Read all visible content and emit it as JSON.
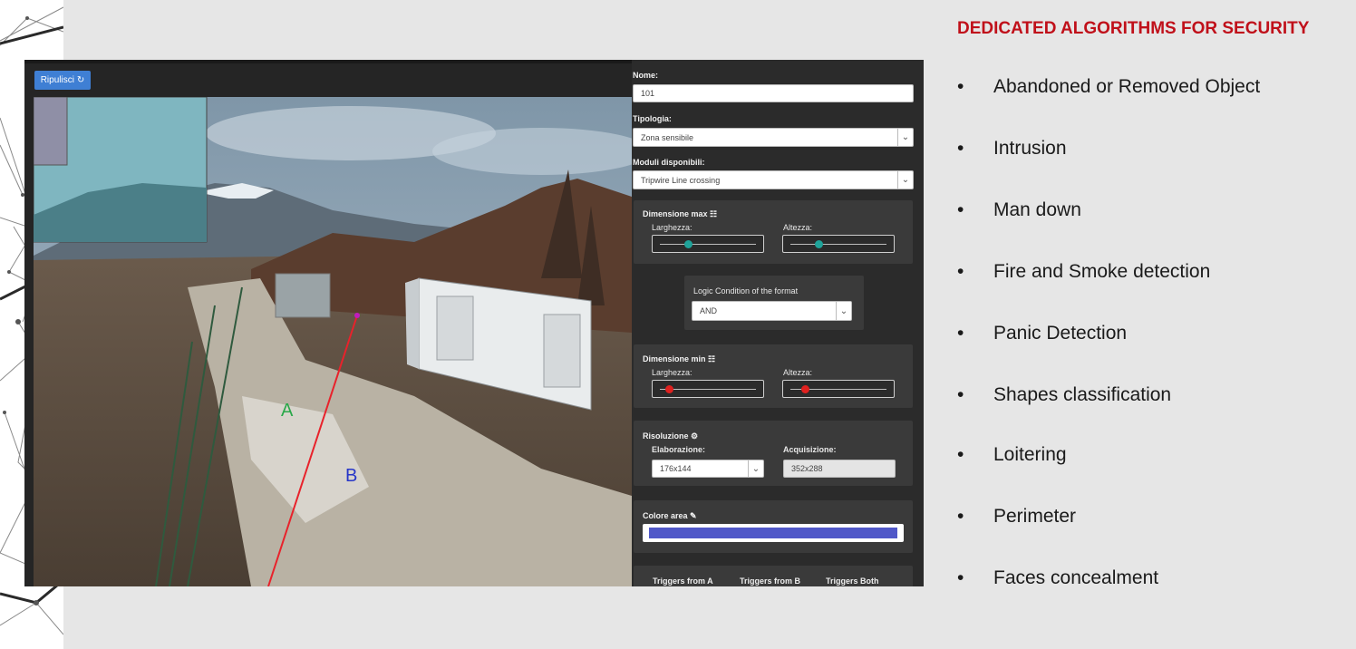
{
  "slide": {
    "title": "DEDICATED ALGORITHMS FOR SECURITY",
    "bullets": [
      "Abandoned or Removed Object",
      "Intrusion",
      "Man down",
      "Fire and Smoke detection",
      "Panic Detection",
      "Shapes classification",
      "Loitering",
      "Perimeter",
      "Faces concealment"
    ]
  },
  "toolbar": {
    "reset_label": "Ripulisci",
    "reset_icon": "refresh-icon"
  },
  "camera": {
    "line_side_a": "A",
    "line_side_b": "B"
  },
  "panel": {
    "name_label": "Nome:",
    "name_value": "101",
    "type_label": "Tipologia:",
    "type_value": "Zona sensibile",
    "modules_label": "Moduli disponibili:",
    "modules_value": "Tripwire Line crossing",
    "max_dim_label": "Dimensione max",
    "width_label": "Larghezza:",
    "height_label": "Altezza:",
    "max_width_level": 0.3,
    "max_height_level": 0.3,
    "logic_label": "Logic Condition of the format",
    "logic_value": "AND",
    "min_dim_label": "Dimensione min",
    "min_width_level": 0.1,
    "min_height_level": 0.15,
    "resolution_label": "Risoluzione",
    "processing_label": "Elaborazione:",
    "processing_value": "176x144",
    "acquisition_label": "Acquisizione:",
    "acquisition_value": "352x288",
    "color_label": "Colore area",
    "area_color": "#5058c8",
    "triggers": [
      "Triggers from A",
      "Triggers from B",
      "Triggers Both"
    ]
  },
  "colors": {
    "accent": "#c0101a",
    "button": "#3f7fd4",
    "slider_max": "#1fa39a",
    "slider_min": "#e0211f",
    "tripwire": "#e8222b"
  }
}
